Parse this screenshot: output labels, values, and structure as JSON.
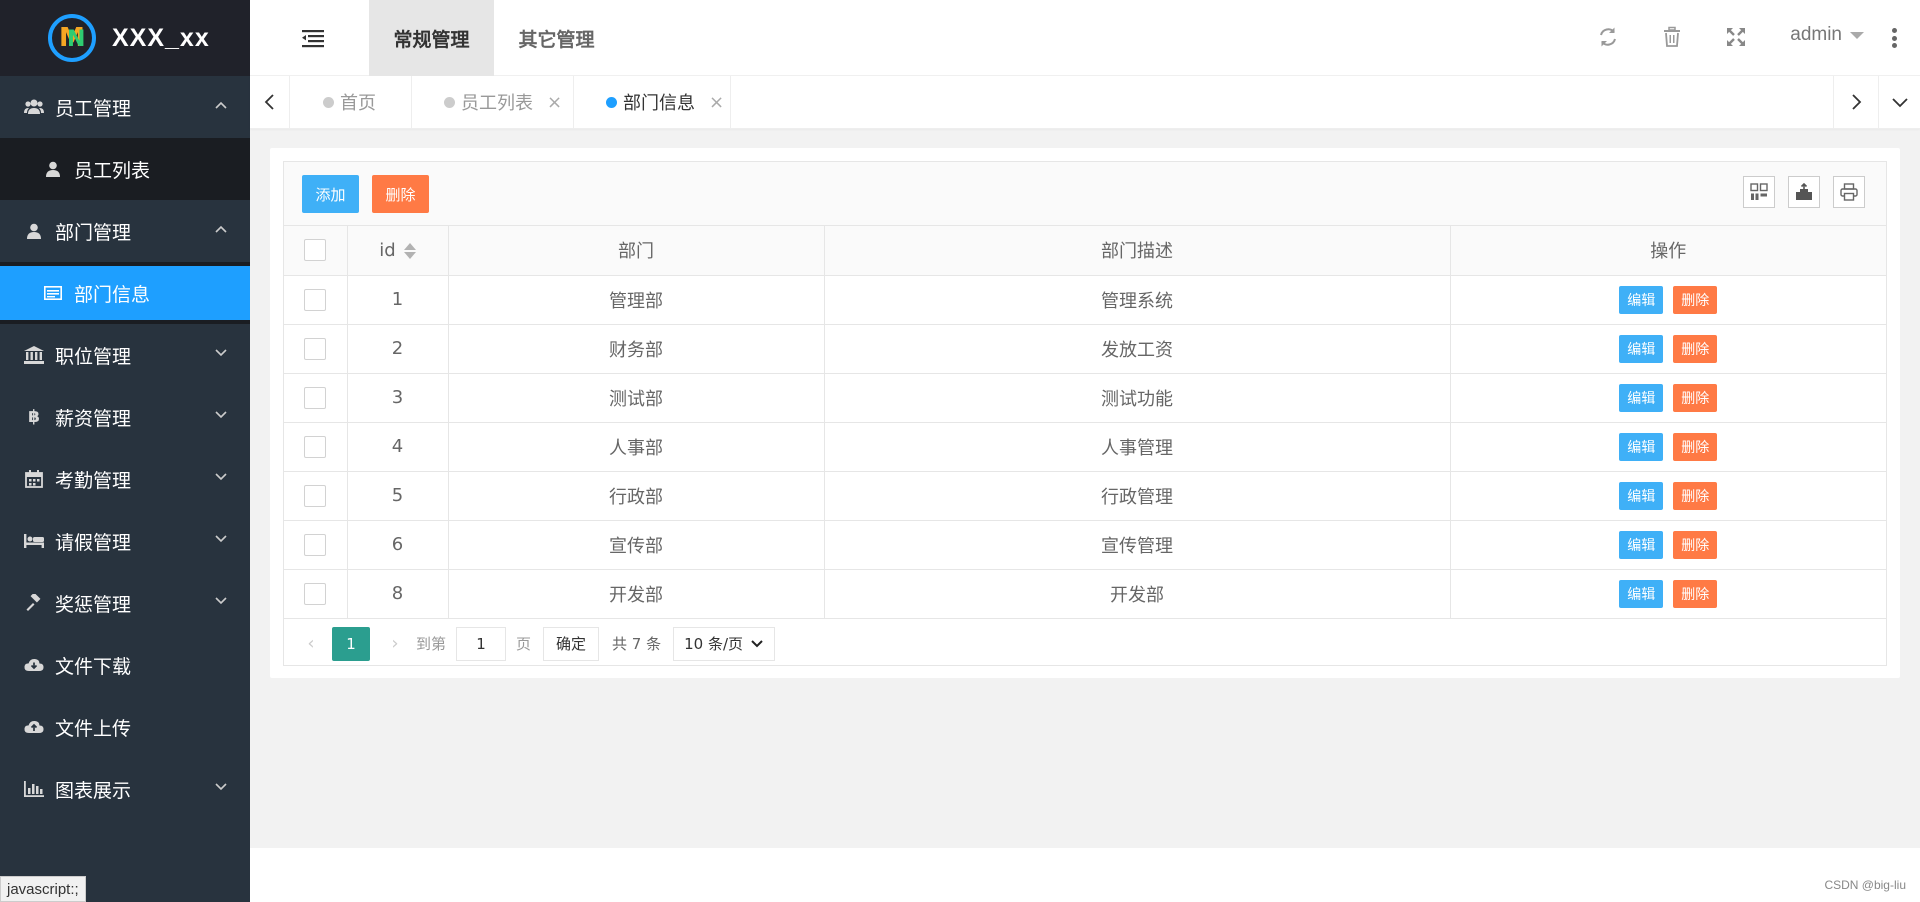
{
  "app": {
    "title": "XXX_xx"
  },
  "sidebar": {
    "groups": [
      {
        "label": "员工管理",
        "icon": "users-icon",
        "expanded": true,
        "children": [
          {
            "label": "员工列表",
            "icon": "user-icon"
          }
        ]
      },
      {
        "label": "部门管理",
        "icon": "user-icon",
        "expanded": true,
        "children": [
          {
            "label": "部门信息",
            "icon": "list-icon",
            "active": true
          }
        ]
      },
      {
        "label": "职位管理",
        "icon": "bank-icon",
        "expanded": false
      },
      {
        "label": "薪资管理",
        "icon": "bitcoin-icon",
        "expanded": false
      },
      {
        "label": "考勤管理",
        "icon": "calendar-icon",
        "expanded": false
      },
      {
        "label": "请假管理",
        "icon": "bed-icon",
        "expanded": false
      },
      {
        "label": "奖惩管理",
        "icon": "gavel-icon",
        "expanded": false
      },
      {
        "label": "文件下载",
        "icon": "cloud-download-icon"
      },
      {
        "label": "文件上传",
        "icon": "cloud-upload-icon"
      },
      {
        "label": "图表展示",
        "icon": "bar-chart-icon",
        "expanded": false
      }
    ]
  },
  "header": {
    "tabs": [
      {
        "label": "常规管理",
        "active": true
      },
      {
        "label": "其它管理",
        "active": false
      }
    ],
    "user": "admin"
  },
  "tabbar": {
    "items": [
      {
        "label": "首页",
        "closable": false,
        "active": false
      },
      {
        "label": "员工列表",
        "closable": true,
        "active": false
      },
      {
        "label": "部门信息",
        "closable": true,
        "active": true
      }
    ],
    "close_glyph": "×"
  },
  "toolbar": {
    "add_label": "添加",
    "delete_label": "删除"
  },
  "table": {
    "columns": [
      "id",
      "部门",
      "部门描述",
      "操作"
    ],
    "rows": [
      {
        "id": "1",
        "dept": "管理部",
        "desc": "管理系统"
      },
      {
        "id": "2",
        "dept": "财务部",
        "desc": "发放工资"
      },
      {
        "id": "3",
        "dept": "测试部",
        "desc": "测试功能"
      },
      {
        "id": "4",
        "dept": "人事部",
        "desc": "人事管理"
      },
      {
        "id": "5",
        "dept": "行政部",
        "desc": "行政管理"
      },
      {
        "id": "6",
        "dept": "宣传部",
        "desc": "宣传管理"
      },
      {
        "id": "8",
        "dept": "开发部",
        "desc": "开发部"
      }
    ],
    "edit_label": "编辑",
    "row_delete_label": "删除"
  },
  "pager": {
    "current": "1",
    "goto_label": "到第",
    "goto_value": "1",
    "page_unit": "页",
    "confirm_label": "确定",
    "total_label": "共 7 条",
    "page_size": "10 条/页"
  },
  "status_tip": "javascript:;",
  "watermark": "CSDN @big-liu",
  "colors": {
    "primary": "#1e9fff",
    "danger": "#ff7a45",
    "sidebar_bg": "#28333e",
    "pager_active": "#2b9e8f"
  }
}
